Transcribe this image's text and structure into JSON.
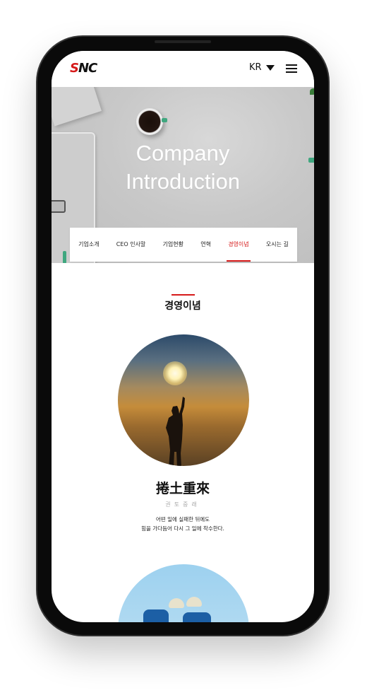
{
  "header": {
    "logo": "SNC",
    "language": "KR",
    "icons": {
      "dropdown": "triangle-down-icon",
      "menu": "hamburger-menu-icon"
    }
  },
  "hero": {
    "title_line1": "Company",
    "title_line2": "Introduction"
  },
  "tabs": [
    {
      "label": "기업소개",
      "active": false
    },
    {
      "label": "CEO 인사말",
      "active": false
    },
    {
      "label": "기업현황",
      "active": false
    },
    {
      "label": "연혁",
      "active": false
    },
    {
      "label": "경영이념",
      "active": true
    },
    {
      "label": "오시는 길",
      "active": false
    }
  ],
  "section": {
    "title": "경영이념",
    "motto": "捲土重來",
    "reading": "권토중래",
    "description_line1": "어떤 일에 실패한 뒤에도",
    "description_line2": "힘을 가다듬어 다시 그 일에 착수한다."
  },
  "colors": {
    "accent": "#d61a1a",
    "text": "#111111",
    "muted": "#aaaaaa"
  }
}
